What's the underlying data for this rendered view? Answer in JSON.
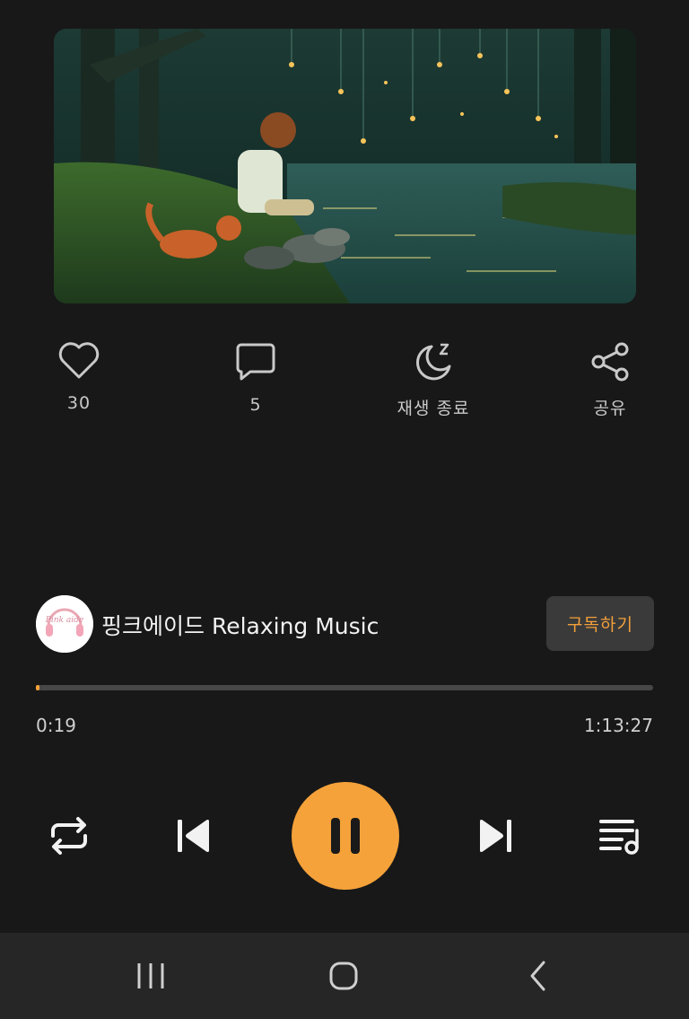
{
  "actions": {
    "like": {
      "icon": "heart-icon",
      "count": "30"
    },
    "comment": {
      "icon": "comment-icon",
      "count": "5"
    },
    "sleep_timer": {
      "icon": "moon-sleep-icon",
      "label": "재생 종료"
    },
    "share": {
      "icon": "share-icon",
      "label": "공유"
    }
  },
  "channel": {
    "name": "핑크에이드 Relaxing Music",
    "avatar_text": "Pink aide",
    "subscribe_label": "구독하기"
  },
  "playback": {
    "current_time": "0:19",
    "total_time": "1:13:27",
    "progress_fraction": 0.0043
  },
  "controls": {
    "repeat": "repeat-icon",
    "previous": "skip-previous-icon",
    "pause": "pause-icon",
    "next": "skip-next-icon",
    "playlist": "playlist-icon"
  },
  "nav": {
    "recents": "recent-apps-icon",
    "home": "home-icon",
    "back": "back-icon"
  },
  "colors": {
    "accent": "#f5a23a",
    "background": "#181818",
    "navbar": "#262626"
  }
}
